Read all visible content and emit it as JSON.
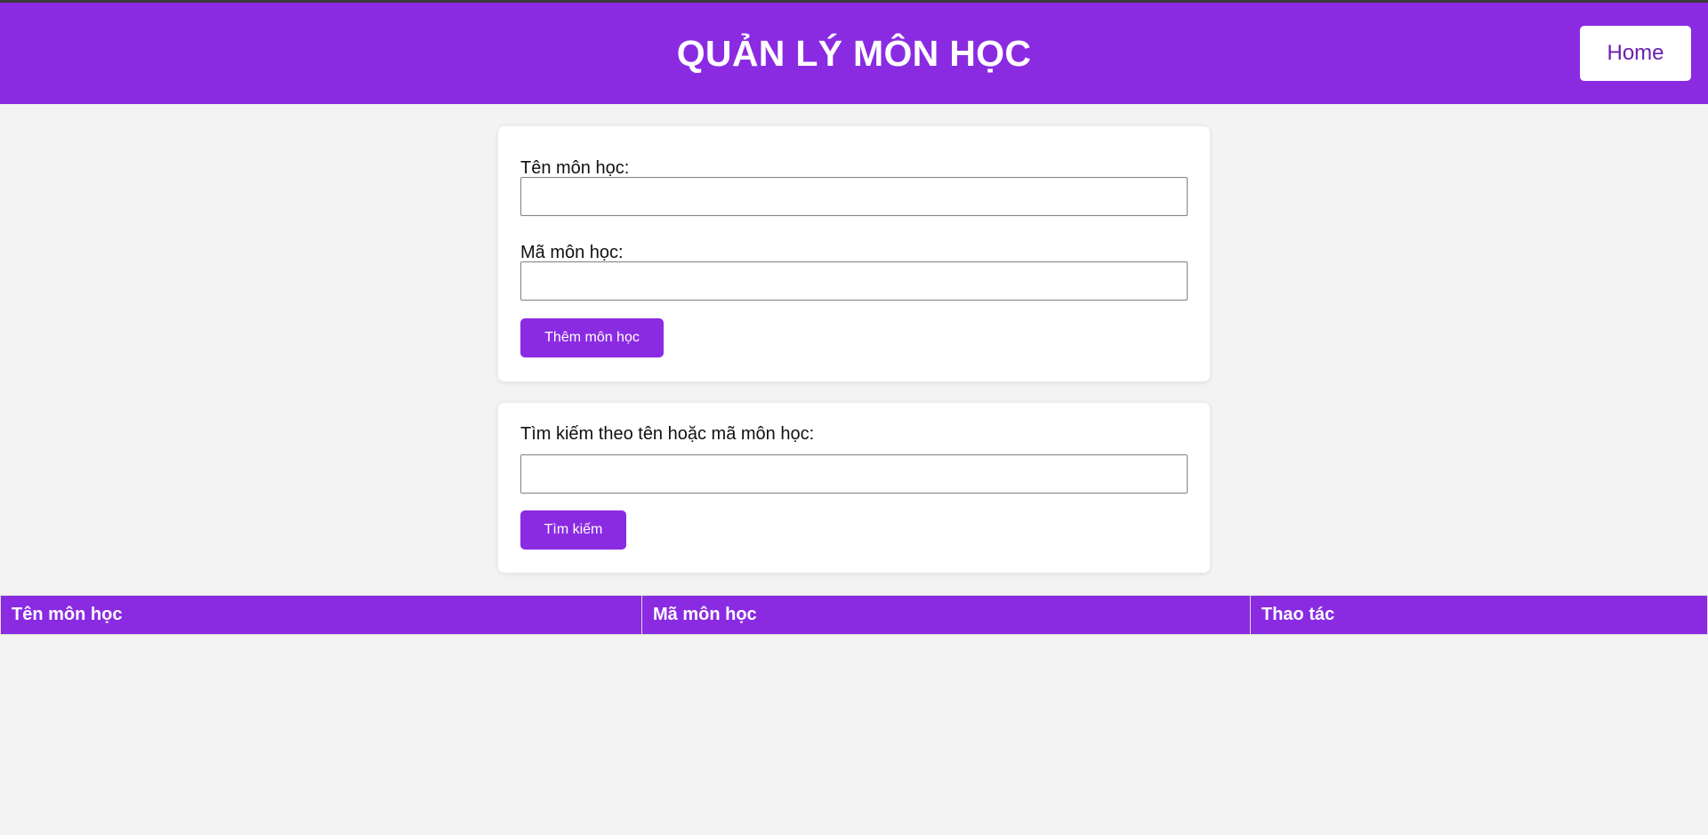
{
  "header": {
    "title": "QUẢN LÝ MÔN HỌC",
    "home_label": "Home"
  },
  "add_form": {
    "name_label": "Tên môn học:",
    "name_value": "",
    "code_label": "Mã môn học:",
    "code_value": "",
    "submit_label": "Thêm môn học"
  },
  "search_form": {
    "label": "Tìm kiếm theo tên hoặc mã môn học:",
    "value": "",
    "submit_label": "Tìm kiếm"
  },
  "table": {
    "columns": [
      "Tên môn học",
      "Mã môn học",
      "Thao tác"
    ],
    "rows": []
  },
  "colors": {
    "accent": "#8a2be2",
    "background": "#f3f3f3"
  }
}
